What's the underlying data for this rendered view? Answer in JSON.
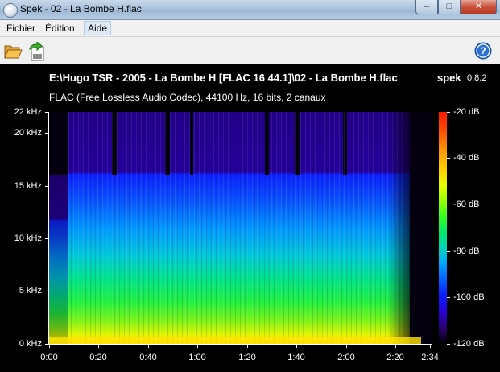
{
  "window": {
    "title": "Spek - 02 - La Bombe H.flac",
    "minimize_glyph": "–",
    "maximize_glyph": "□",
    "close_glyph": "✕"
  },
  "menu": {
    "items": [
      {
        "label": "Fichier"
      },
      {
        "label": "Édition"
      },
      {
        "label": "Aide"
      }
    ]
  },
  "toolbar": {
    "open_icon": "folder-open-icon",
    "save_icon": "save-export-icon",
    "help_icon": "help-icon",
    "help_glyph": "?"
  },
  "spectrogram": {
    "file_title": "E:\\Hugo TSR - 2005 - La Bombe H [FLAC 16 44.1]\\02 - La Bombe H.flac",
    "app_name": "spek",
    "app_version": "0.8.2",
    "codec_info": "FLAC (Free Lossless Audio Codec), 44100 Hz, 16 bits, 2 canaux",
    "freq_labels": [
      "22 kHz",
      "20 kHz",
      "15 kHz",
      "10 kHz",
      "5 kHz",
      "0 kHz"
    ],
    "time_labels": [
      "0:00",
      "0:20",
      "0:40",
      "1:00",
      "1:20",
      "1:40",
      "2:00",
      "2:20",
      "2:34"
    ],
    "db_labels": [
      "-20 dB",
      "-40 dB",
      "-60 dB",
      "-80 dB",
      "-100 dB",
      "-120 dB"
    ],
    "colors": {
      "background": "#000000",
      "high": "#ff1800",
      "low": "#2a00d8"
    }
  }
}
